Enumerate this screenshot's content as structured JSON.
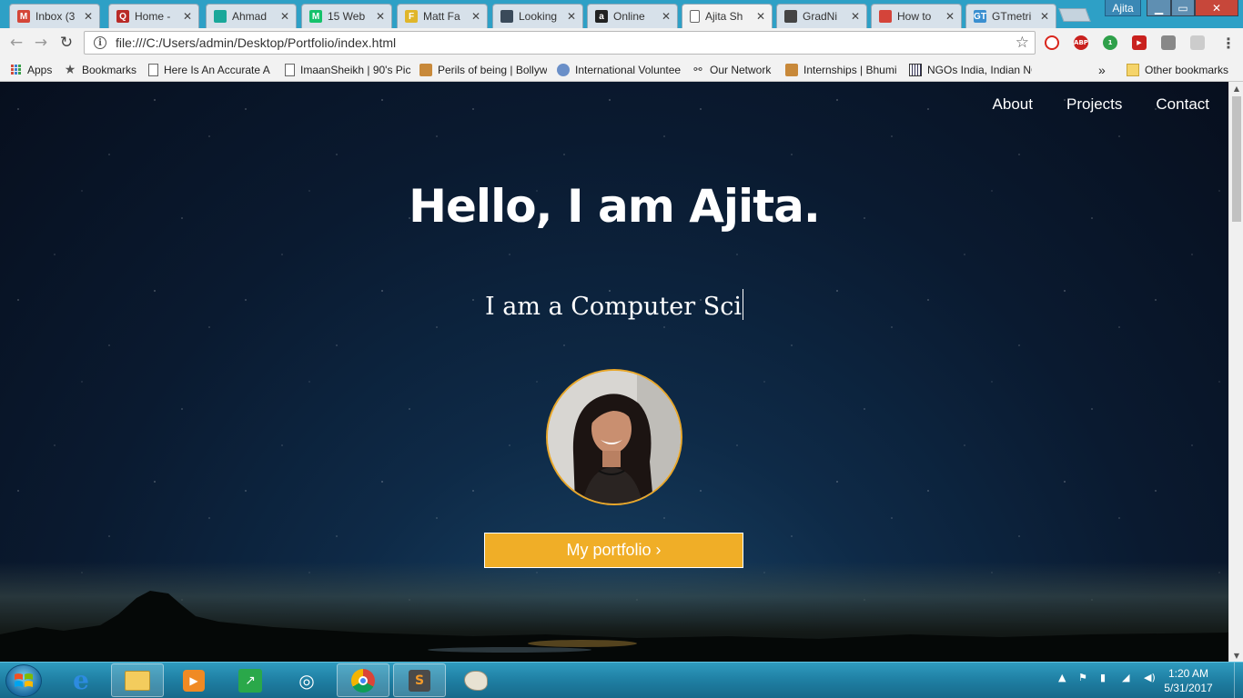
{
  "browser": {
    "tabs": [
      {
        "label": "Inbox (3",
        "icon": "gmail-icon",
        "color": "#d44638",
        "glyph": "M",
        "active": false
      },
      {
        "label": "Home -",
        "icon": "quora-icon",
        "color": "#b92b27",
        "glyph": "Q",
        "active": false
      },
      {
        "label": "Ahmad",
        "icon": "site-icon",
        "color": "#1aa89a",
        "glyph": "",
        "active": false
      },
      {
        "label": "15 Web",
        "icon": "medium-icon",
        "color": "#15c26b",
        "glyph": "M",
        "active": false
      },
      {
        "label": "Matt Fa",
        "icon": "site-icon",
        "color": "#e0b62a",
        "glyph": "F",
        "active": false
      },
      {
        "label": "Looking",
        "icon": "site-icon",
        "color": "#3a4a5a",
        "glyph": "",
        "active": false
      },
      {
        "label": "Online",
        "icon": "amazon-icon",
        "color": "#222222",
        "glyph": "a",
        "active": false
      },
      {
        "label": "Ajita Sh",
        "icon": "document-icon",
        "color": "#ffffff",
        "glyph": "",
        "active": true
      },
      {
        "label": "GradNi",
        "icon": "gradcap-icon",
        "color": "#444444",
        "glyph": "",
        "active": false
      },
      {
        "label": "How to",
        "icon": "site-icon",
        "color": "#d4443a",
        "glyph": "",
        "active": false
      },
      {
        "label": "GTmetri",
        "icon": "gtmetrix-icon",
        "color": "#3a8fd0",
        "glyph": "GT",
        "active": false
      }
    ],
    "close_glyph": "✕",
    "profile_name": "Ajita",
    "url": "file:///C:/Users/admin/Desktop/Portfolio/index.html"
  },
  "bookmarks": {
    "items": [
      {
        "label": "Apps",
        "icon": "apps-grid-icon"
      },
      {
        "label": "Bookmarks",
        "icon": "star-icon"
      },
      {
        "label": "Here Is An Accurate A",
        "icon": "page-icon"
      },
      {
        "label": "ImaanSheikh | 90's Pic",
        "icon": "page-icon"
      },
      {
        "label": "Perils of being | Bollyw",
        "icon": "site-icon"
      },
      {
        "label": "International Voluntee",
        "icon": "globe-icon"
      },
      {
        "label": "Our Network",
        "icon": "network-icon"
      },
      {
        "label": "Internships | Bhumi",
        "icon": "site-icon"
      },
      {
        "label": "NGOs India, Indian NG",
        "icon": "grid-icon"
      }
    ],
    "overflow": "»",
    "other": "Other bookmarks"
  },
  "site": {
    "nav": [
      "About",
      "Projects",
      "Contact"
    ],
    "title": "Hello, I am Ajita.",
    "subtitle": "I am a Computer Sci",
    "cta": "My portfolio ›"
  },
  "colors": {
    "accent": "#f0ae27",
    "taskbar": "#1f7fa3",
    "tabstrip": "#2ea0c6"
  },
  "taskbar": {
    "time": "1:20 AM",
    "date": "5/31/2017"
  }
}
